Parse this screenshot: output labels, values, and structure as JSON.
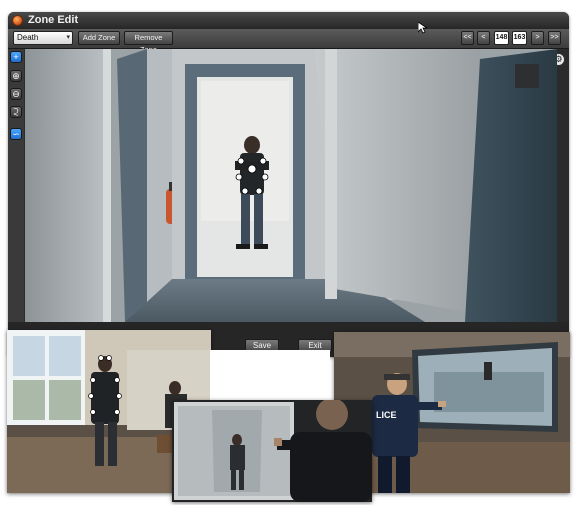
{
  "window": {
    "title": "Zone Edit"
  },
  "toolbar": {
    "zone_select_value": "Death",
    "add_zone_label": "Add Zone",
    "remove_zone_label": "Remove Zone",
    "first_label": "<<",
    "prev_label": "<",
    "frame_start": "148",
    "frame_end": "163",
    "next_label": ">",
    "last_label": ">>"
  },
  "tools": [
    "add",
    "zoom-in",
    "zoom-out",
    "share",
    "path"
  ],
  "footer": {
    "save_label": "Save",
    "exit_label": "Exit"
  },
  "colors": {
    "active_tool": "#2a86ea",
    "window_bg": "#2b2b2b",
    "toolbar_bg": "#4a4a4a"
  }
}
